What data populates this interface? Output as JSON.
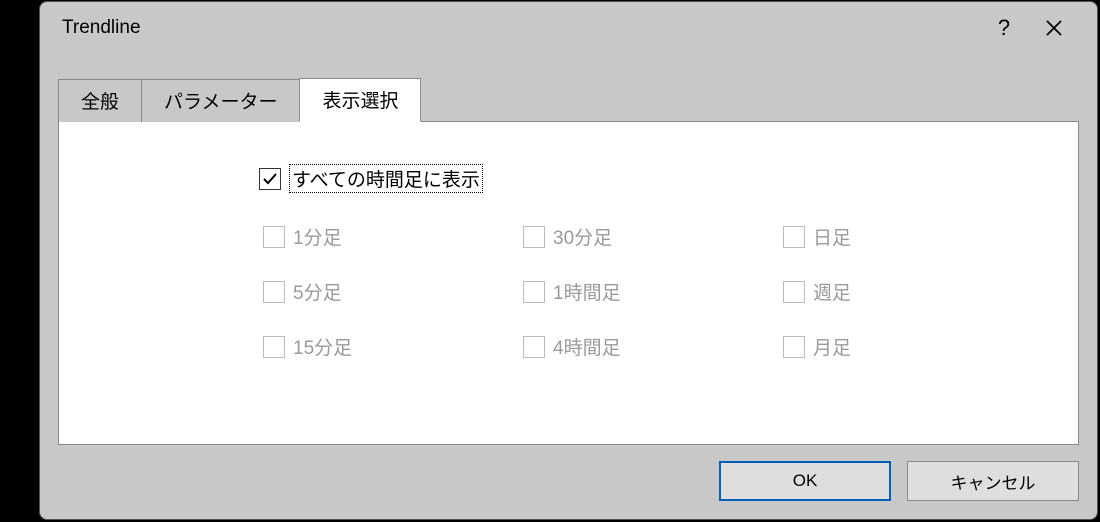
{
  "dialog": {
    "title": "Trendline",
    "help_symbol": "?"
  },
  "tabs": {
    "general": "全般",
    "parameters": "パラメーター",
    "display": "表示選択"
  },
  "display_panel": {
    "show_all_timeframes": "すべての時間足に表示",
    "timeframes": {
      "m1": "1分足",
      "m5": "5分足",
      "m15": "15分足",
      "m30": "30分足",
      "h1": "1時間足",
      "h4": "4時間足",
      "d1": "日足",
      "w1": "週足",
      "mn": "月足"
    }
  },
  "buttons": {
    "ok": "OK",
    "cancel": "キャンセル"
  }
}
